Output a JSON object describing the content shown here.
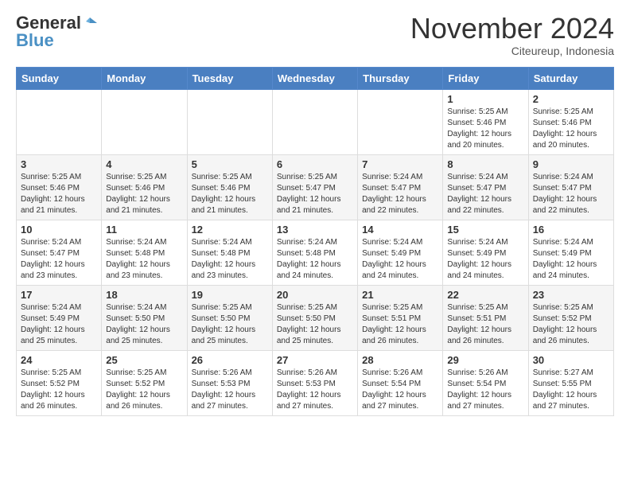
{
  "header": {
    "logo_general": "General",
    "logo_blue": "Blue",
    "month_title": "November 2024",
    "location": "Citeureup, Indonesia"
  },
  "days_of_week": [
    "Sunday",
    "Monday",
    "Tuesday",
    "Wednesday",
    "Thursday",
    "Friday",
    "Saturday"
  ],
  "weeks": [
    [
      {
        "day": "",
        "info": ""
      },
      {
        "day": "",
        "info": ""
      },
      {
        "day": "",
        "info": ""
      },
      {
        "day": "",
        "info": ""
      },
      {
        "day": "",
        "info": ""
      },
      {
        "day": "1",
        "info": "Sunrise: 5:25 AM\nSunset: 5:46 PM\nDaylight: 12 hours\nand 20 minutes."
      },
      {
        "day": "2",
        "info": "Sunrise: 5:25 AM\nSunset: 5:46 PM\nDaylight: 12 hours\nand 20 minutes."
      }
    ],
    [
      {
        "day": "3",
        "info": "Sunrise: 5:25 AM\nSunset: 5:46 PM\nDaylight: 12 hours\nand 21 minutes."
      },
      {
        "day": "4",
        "info": "Sunrise: 5:25 AM\nSunset: 5:46 PM\nDaylight: 12 hours\nand 21 minutes."
      },
      {
        "day": "5",
        "info": "Sunrise: 5:25 AM\nSunset: 5:46 PM\nDaylight: 12 hours\nand 21 minutes."
      },
      {
        "day": "6",
        "info": "Sunrise: 5:25 AM\nSunset: 5:47 PM\nDaylight: 12 hours\nand 21 minutes."
      },
      {
        "day": "7",
        "info": "Sunrise: 5:24 AM\nSunset: 5:47 PM\nDaylight: 12 hours\nand 22 minutes."
      },
      {
        "day": "8",
        "info": "Sunrise: 5:24 AM\nSunset: 5:47 PM\nDaylight: 12 hours\nand 22 minutes."
      },
      {
        "day": "9",
        "info": "Sunrise: 5:24 AM\nSunset: 5:47 PM\nDaylight: 12 hours\nand 22 minutes."
      }
    ],
    [
      {
        "day": "10",
        "info": "Sunrise: 5:24 AM\nSunset: 5:47 PM\nDaylight: 12 hours\nand 23 minutes."
      },
      {
        "day": "11",
        "info": "Sunrise: 5:24 AM\nSunset: 5:48 PM\nDaylight: 12 hours\nand 23 minutes."
      },
      {
        "day": "12",
        "info": "Sunrise: 5:24 AM\nSunset: 5:48 PM\nDaylight: 12 hours\nand 23 minutes."
      },
      {
        "day": "13",
        "info": "Sunrise: 5:24 AM\nSunset: 5:48 PM\nDaylight: 12 hours\nand 24 minutes."
      },
      {
        "day": "14",
        "info": "Sunrise: 5:24 AM\nSunset: 5:49 PM\nDaylight: 12 hours\nand 24 minutes."
      },
      {
        "day": "15",
        "info": "Sunrise: 5:24 AM\nSunset: 5:49 PM\nDaylight: 12 hours\nand 24 minutes."
      },
      {
        "day": "16",
        "info": "Sunrise: 5:24 AM\nSunset: 5:49 PM\nDaylight: 12 hours\nand 24 minutes."
      }
    ],
    [
      {
        "day": "17",
        "info": "Sunrise: 5:24 AM\nSunset: 5:49 PM\nDaylight: 12 hours\nand 25 minutes."
      },
      {
        "day": "18",
        "info": "Sunrise: 5:24 AM\nSunset: 5:50 PM\nDaylight: 12 hours\nand 25 minutes."
      },
      {
        "day": "19",
        "info": "Sunrise: 5:25 AM\nSunset: 5:50 PM\nDaylight: 12 hours\nand 25 minutes."
      },
      {
        "day": "20",
        "info": "Sunrise: 5:25 AM\nSunset: 5:50 PM\nDaylight: 12 hours\nand 25 minutes."
      },
      {
        "day": "21",
        "info": "Sunrise: 5:25 AM\nSunset: 5:51 PM\nDaylight: 12 hours\nand 26 minutes."
      },
      {
        "day": "22",
        "info": "Sunrise: 5:25 AM\nSunset: 5:51 PM\nDaylight: 12 hours\nand 26 minutes."
      },
      {
        "day": "23",
        "info": "Sunrise: 5:25 AM\nSunset: 5:52 PM\nDaylight: 12 hours\nand 26 minutes."
      }
    ],
    [
      {
        "day": "24",
        "info": "Sunrise: 5:25 AM\nSunset: 5:52 PM\nDaylight: 12 hours\nand 26 minutes."
      },
      {
        "day": "25",
        "info": "Sunrise: 5:25 AM\nSunset: 5:52 PM\nDaylight: 12 hours\nand 26 minutes."
      },
      {
        "day": "26",
        "info": "Sunrise: 5:26 AM\nSunset: 5:53 PM\nDaylight: 12 hours\nand 27 minutes."
      },
      {
        "day": "27",
        "info": "Sunrise: 5:26 AM\nSunset: 5:53 PM\nDaylight: 12 hours\nand 27 minutes."
      },
      {
        "day": "28",
        "info": "Sunrise: 5:26 AM\nSunset: 5:54 PM\nDaylight: 12 hours\nand 27 minutes."
      },
      {
        "day": "29",
        "info": "Sunrise: 5:26 AM\nSunset: 5:54 PM\nDaylight: 12 hours\nand 27 minutes."
      },
      {
        "day": "30",
        "info": "Sunrise: 5:27 AM\nSunset: 5:55 PM\nDaylight: 12 hours\nand 27 minutes."
      }
    ]
  ]
}
